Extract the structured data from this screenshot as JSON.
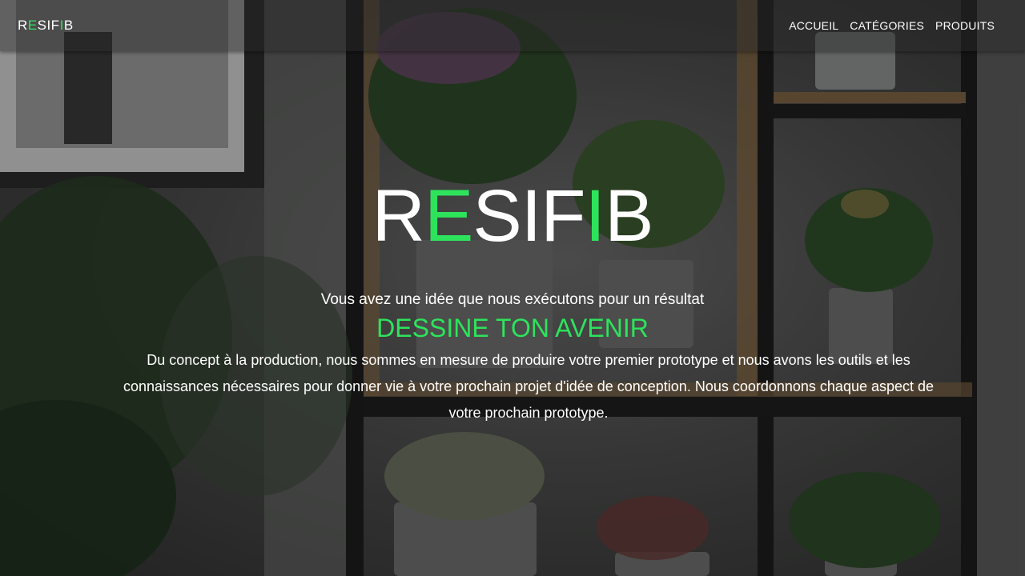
{
  "nav": {
    "logo": {
      "p1": "R",
      "p2": "E",
      "p3": "SIF",
      "p4": "I",
      "p5": "B"
    },
    "links": [
      "ACCUEIL",
      "CATÉGORIES",
      "PRODUITS"
    ]
  },
  "hero": {
    "title": {
      "p1": "R",
      "p2": "E",
      "p3": "SIF",
      "p4": "I",
      "p5": "B"
    },
    "tagline": "Vous avez une idée que nous exécutons pour un résultat",
    "slogan": "DESSINE TON AVENIR",
    "description": "Du concept à la production, nous sommes en mesure de produire votre premier prototype et nous avons les outils et les connaissances nécessaires pour donner vie à votre prochain projet d'idée de conception. Nous coordonnons chaque aspect de votre prochain prototype."
  },
  "colors": {
    "accent": "#2ee35c",
    "text": "#ffffff"
  }
}
